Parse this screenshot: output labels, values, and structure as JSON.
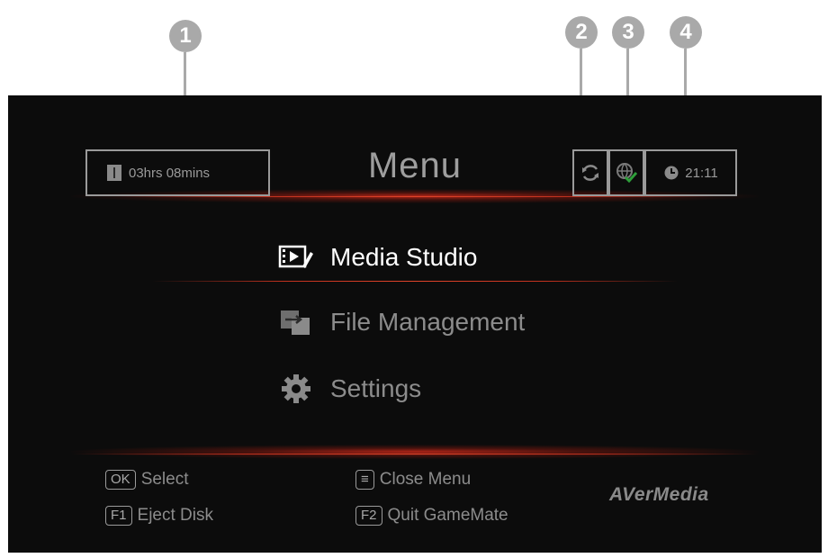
{
  "callouts": [
    "1",
    "2",
    "3",
    "4"
  ],
  "header": {
    "recording_time": "03hrs 08mins",
    "title": "Menu",
    "clock": "21:11"
  },
  "icons": {
    "storage": "usb-storage-icon",
    "sync": "sync-icon",
    "network": "network-connected-icon",
    "clock": "clock-icon",
    "media_studio": "media-studio-icon",
    "file_management": "file-management-icon",
    "settings": "settings-gear-icon"
  },
  "menu": {
    "items": [
      {
        "label": "Media Studio",
        "selected": true
      },
      {
        "label": "File Management",
        "selected": false
      },
      {
        "label": "Settings",
        "selected": false
      }
    ]
  },
  "footer": {
    "ok_key": "OK",
    "ok_label": "Select",
    "f1_key": "F1",
    "f1_label": "Eject Disk",
    "menu_key": "≡",
    "menu_label": "Close Menu",
    "f2_key": "F2",
    "f2_label": "Quit GameMate",
    "brand": "AVerMedia"
  },
  "colors": {
    "screen_bg": "#0c0c0c",
    "glow": "#c0311e",
    "check": "#2e9e3a",
    "callout": "#a9a9a9"
  }
}
